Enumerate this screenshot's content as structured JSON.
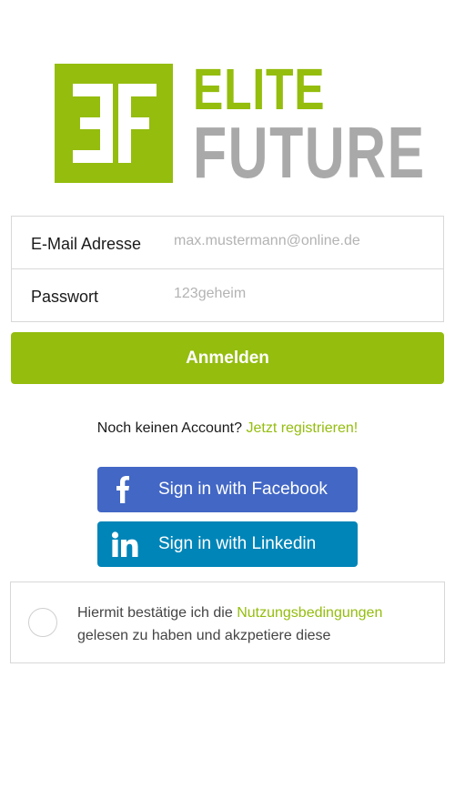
{
  "logo": {
    "line1": "ELITE",
    "line2": "FUTURE",
    "mark": "EF",
    "green": "#94bd0e",
    "gray": "#a9a9a9"
  },
  "form": {
    "email_label": "E-Mail Adresse",
    "email_placeholder": "max.mustermann@online.de",
    "password_label": "Passwort",
    "password_placeholder": "123geheim"
  },
  "login_button": "Anmelden",
  "register": {
    "prompt": "Noch keinen Account?",
    "link": "Jetzt registrieren!"
  },
  "social": {
    "facebook": {
      "label": "Sign in with Facebook",
      "icon": "facebook-icon",
      "color": "#4267c5"
    },
    "linkedin": {
      "label": "Sign in with Linkedin",
      "icon": "linkedin-icon",
      "color": "#0085b8"
    }
  },
  "terms": {
    "text_before": "Hiermit bestätige ich die",
    "link": "Nutzungsbedingungen",
    "text_after": "gelesen zu haben und akzpetiere diese"
  }
}
